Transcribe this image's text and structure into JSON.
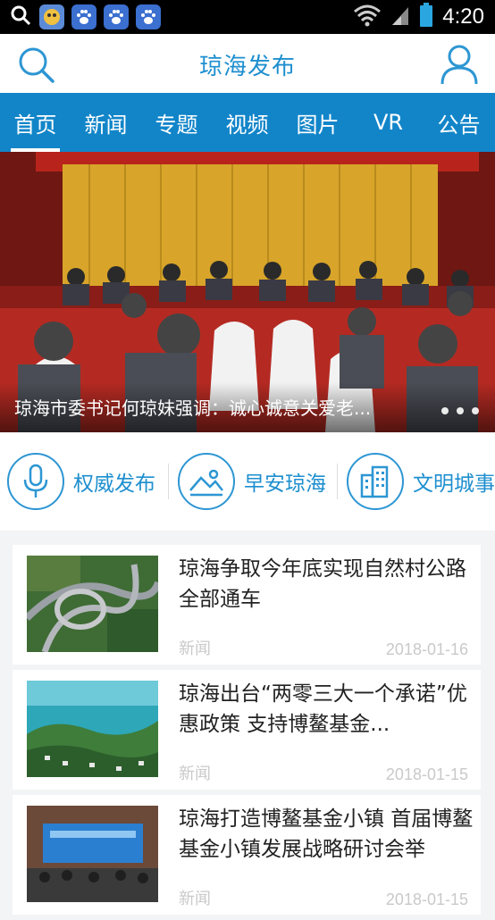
{
  "status_bar": {
    "time": "4:20",
    "icons": [
      "search-icon",
      "app-icon",
      "paw-icon",
      "paw-icon",
      "paw-icon",
      "wifi-icon",
      "signal-icon",
      "battery-icon"
    ]
  },
  "header": {
    "title": "琼海发布"
  },
  "tabs": [
    {
      "label": "首页",
      "active": true
    },
    {
      "label": "新闻"
    },
    {
      "label": "专题"
    },
    {
      "label": "视频"
    },
    {
      "label": "图片"
    },
    {
      "label": "VR"
    },
    {
      "label": "公告"
    }
  ],
  "banner": {
    "caption": "琼海市委书记何琼妹强调：诚心诚意关爱老..."
  },
  "quick_links": [
    {
      "label": "权威发布",
      "icon": "microphone-icon"
    },
    {
      "label": "早安琼海",
      "icon": "landscape-icon"
    },
    {
      "label": "文明城事",
      "icon": "buildings-icon"
    }
  ],
  "news": [
    {
      "title": "琼海争取今年底实现自然村公路全部通车",
      "source": "新闻",
      "date": "2018-01-16"
    },
    {
      "title": "琼海出台“两零三大一个承诺”优惠政策 支持博鳌基金...",
      "source": "新闻",
      "date": "2018-01-15"
    },
    {
      "title": "琼海打造博鳌基金小镇 首届博鳌基金小镇发展战略研讨会举",
      "source": "新闻",
      "date": "2018-01-15"
    }
  ],
  "colors": {
    "brand": "#1285c9",
    "title": "#1e8fcf"
  }
}
